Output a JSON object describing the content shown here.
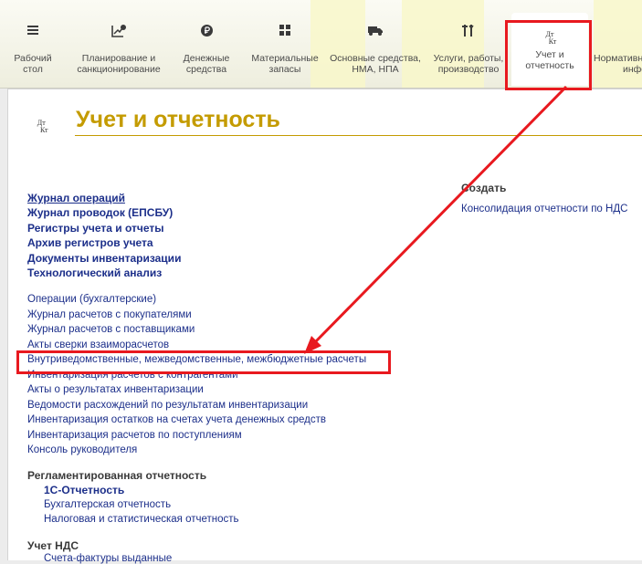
{
  "toolbar": {
    "items": [
      {
        "label": "Рабочий стол",
        "line1": "Рабочий",
        "line2": "стол",
        "icon": "menu-icon"
      },
      {
        "label": "Планирование и санкционирование",
        "line1": "Планирование и",
        "line2": "санкционирование",
        "icon": "planning-icon"
      },
      {
        "label": "Денежные средства",
        "line1": "Денежные",
        "line2": "средства",
        "icon": "ruble-coin-icon"
      },
      {
        "label": "Материальные запасы",
        "line1": "Материальные",
        "line2": "запасы",
        "icon": "grid-icon"
      },
      {
        "label": "Основные средства, НМА, НПА",
        "line1": "Основные средства,",
        "line2": "НМА, НПА",
        "icon": "truck-icon"
      },
      {
        "label": "Услуги, работы, производство",
        "line1": "Услуги, работы,",
        "line2": "производство",
        "icon": "tools-icon"
      },
      {
        "label": "Учет и отчетность",
        "line1": "Учет и",
        "line2": "отчетность",
        "icon": "dt-kt-icon"
      },
      {
        "label": "Нормативно-справочная информация",
        "line1": "Нормативн",
        "line2": "инфо",
        "icon": ""
      }
    ],
    "active_item": "Учет и отчетность"
  },
  "page": {
    "icon_top": "Дт",
    "icon_bottom": "Кт",
    "title": "Учет и отчетность"
  },
  "main_links": [
    "Журнал операций",
    "Журнал проводок (ЕПСБУ)",
    "Регистры учета и отчеты",
    "Архив регистров учета",
    "Документы инвентаризации",
    "Технологический анализ"
  ],
  "links": [
    "Операции (бухгалтерские)",
    "Журнал расчетов с покупателями",
    "Журнал расчетов с поставщиками",
    "Акты сверки взаиморасчетов",
    "Внутриведомственные, межведомственные, межбюджетные расчеты",
    "Инвентаризация расчетов с контрагентами",
    "Акты о результатах инвентаризации",
    "Ведомости расхождений по результатам инвентаризации",
    "Инвентаризация остатков на счетах учета денежных средств",
    "Инвентаризация расчетов по поступлениям",
    "Консоль руководителя"
  ],
  "reporting": {
    "header": "Регламентированная отчетность",
    "items": [
      "1С-Отчетность",
      "Бухгалтерская отчетность",
      "Налоговая и статистическая отчетность"
    ]
  },
  "vat": {
    "header": "Учет НДС",
    "items": [
      "Счета-фактуры выданные"
    ]
  },
  "create": {
    "header": "Создать",
    "items": [
      "Консолидация отчетности по НДС"
    ]
  },
  "annotation_color": "#e8191f",
  "accent_color": "#c49b00",
  "link_color": "#1c2f8a"
}
